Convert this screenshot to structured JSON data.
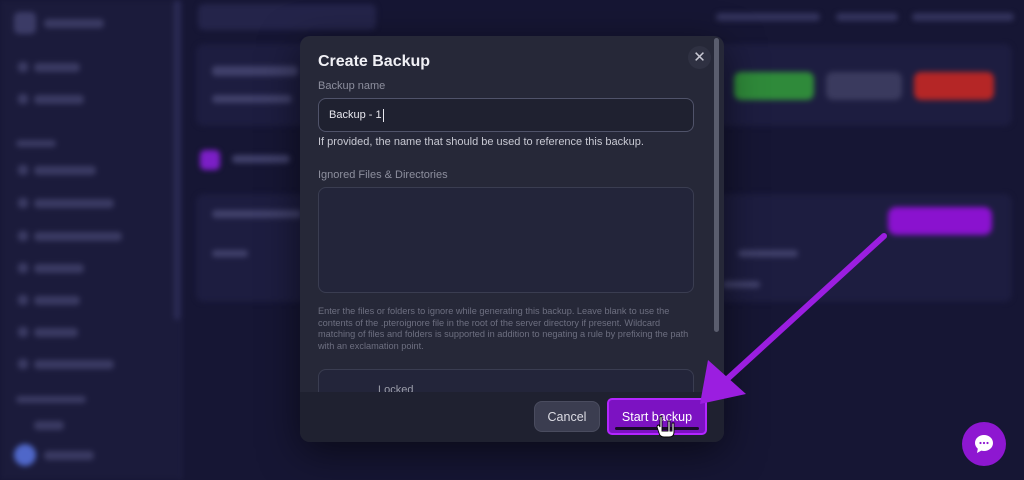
{
  "modal": {
    "title": "Create Backup",
    "close_icon": "close-icon",
    "backup_name_label": "Backup name",
    "backup_name_value": "Backup - 1",
    "backup_name_help": "If provided, the name that should be used to reference this backup.",
    "ignored_label": "Ignored Files & Directories",
    "ignored_value": "",
    "ignored_help": "Enter the files or folders to ignore while generating this backup. Leave blank to use the contents of the .pteroignore file in the root of the server directory if present. Wildcard matching of files and folders is supported in addition to negating a rule by prefixing the path with an exclamation point.",
    "locked_label": "Locked",
    "cancel_label": "Cancel",
    "start_label": "Start backup"
  },
  "annotation": {
    "arrow_color": "#9b1ee0"
  },
  "chat": {
    "icon": "chat-bubble-icon",
    "color": "#8e17d1"
  },
  "colors": {
    "accent": "#7c12c2",
    "modal_bg": "#262838",
    "page_bg": "#161634"
  }
}
